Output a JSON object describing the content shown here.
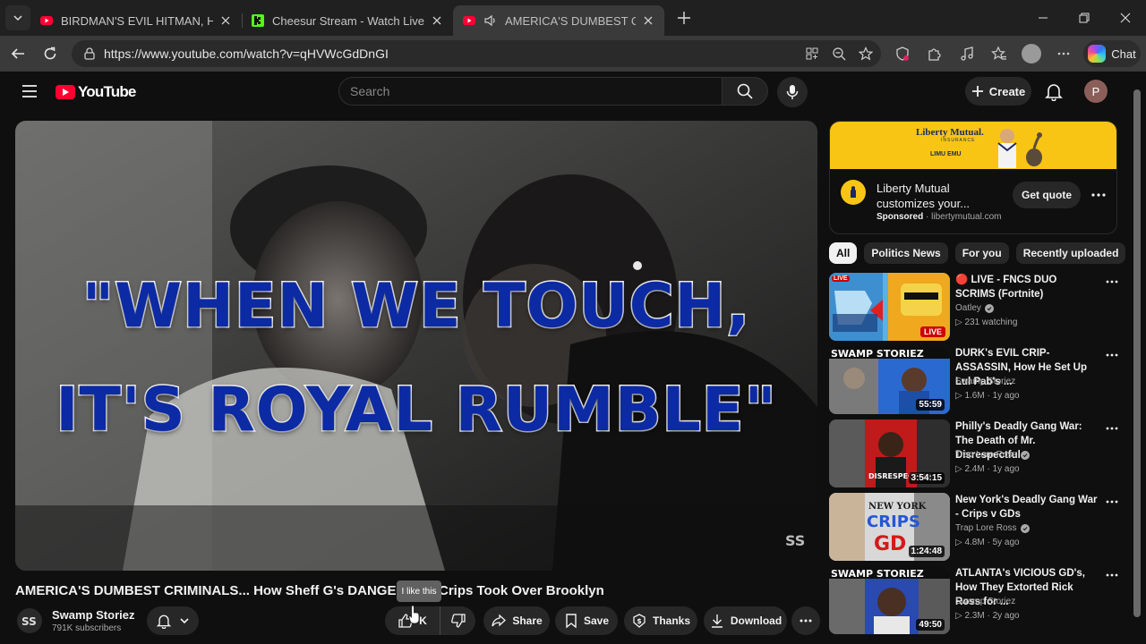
{
  "browser": {
    "tabs": [
      {
        "title": "BIRDMAN'S EVIL HITMAN, How Ha",
        "favicon": "youtube-icon",
        "active": false
      },
      {
        "title": "Cheesur Stream - Watch Live on K",
        "favicon": "kick-icon",
        "active": false
      },
      {
        "title": "AMERICA'S DUMBEST CRIMIN",
        "favicon": "youtube-icon",
        "active": true,
        "audio": true
      }
    ],
    "url": "https://www.youtube.com/watch?v=qHVWcGdDnGI",
    "chat_label": "Chat"
  },
  "youtube": {
    "logo_text": "YouTube",
    "search_placeholder": "Search",
    "create_label": "Create",
    "avatar_letter": "P"
  },
  "video": {
    "overlay_line1": "\"WHEN WE TOUCH,",
    "overlay_line2": "IT'S ROYAL RUMBLE\"",
    "title": "AMERICA'S DUMBEST CRIMINALS... How Sheff G's DANGEROUS Crips Took Over Brooklyn",
    "tooltip": "I like this",
    "channel": "Swamp Storiez",
    "subscribers": "791K subscribers",
    "like_count": "K",
    "share_label": "Share",
    "save_label": "Save",
    "thanks_label": "Thanks",
    "download_label": "Download"
  },
  "ad": {
    "brand_logo": "Liberty Mutual.",
    "brand_sub": "INSURANCE",
    "banner_tag": "LIMU EMU",
    "title": "Liberty Mutual customizes your...",
    "sponsored": "Sponsored",
    "domain": "libertymutual.com",
    "cta": "Get quote"
  },
  "chips": [
    "All",
    "Politics News",
    "For you",
    "Recently uploaded"
  ],
  "recommendations": [
    {
      "title": "🔴 LIVE - FNCS DUO SCRIMS (Fortnite)",
      "channel": "Oatley",
      "meta": "231 watching",
      "badge": "LIVE",
      "verified": true
    },
    {
      "title": "DURK's EVIL CRIP-ASSASSIN, How He Set Up Lul Pab's ...",
      "channel": "Swamp Storiez",
      "meta": "1.6M · 1y ago",
      "badge": "55:59",
      "verified": false
    },
    {
      "title": "Philly's Deadly Gang War: The Death of Mr. Disrespectful",
      "channel": "Trap Lore Ross",
      "meta": "2.4M · 1y ago",
      "badge": "3:54:15",
      "verified": true
    },
    {
      "title": "New York's Deadly Gang War - Crips v GDs",
      "channel": "Trap Lore Ross",
      "meta": "4.8M · 5y ago",
      "badge": "1:24:48",
      "verified": true
    },
    {
      "title": "ATLANTA's VICIOUS GD's, How They Extorted Rick Ross for ...",
      "channel": "Swamp Storiez",
      "meta": "2.3M · 2y ago",
      "badge": "49:50",
      "verified": false
    }
  ],
  "colors": {
    "accent": "#ff0033",
    "background": "#0f0f0f",
    "overlay_text": "#0c2aa4",
    "ad_banner": "#f9c515"
  }
}
